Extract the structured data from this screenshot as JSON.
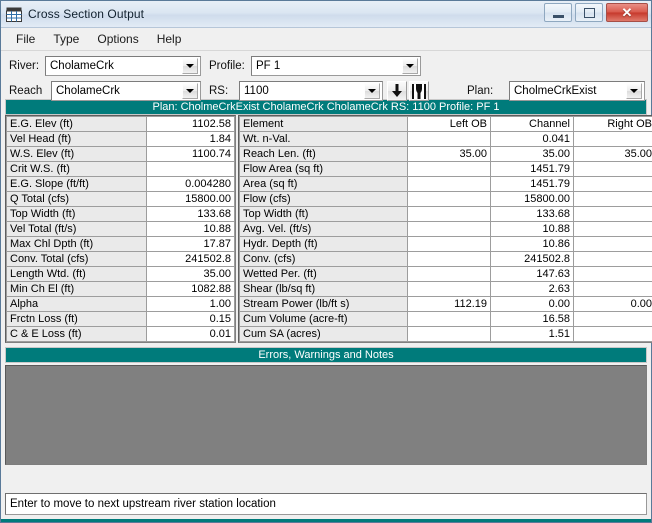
{
  "window": {
    "title": "Cross Section Output",
    "icon": "table-grid-icon",
    "minimize_label": "",
    "maximize_label": "",
    "close_label": "✕"
  },
  "menu": {
    "items": [
      {
        "label": "File"
      },
      {
        "label": "Type"
      },
      {
        "label": "Options"
      },
      {
        "label": "Help"
      }
    ]
  },
  "selectors": {
    "river_label": "River:",
    "river_value": "CholameCrk",
    "reach_label": "Reach",
    "reach_value": "CholameCrk",
    "profile_label": "Profile:",
    "profile_value": "PF 1",
    "rs_label": "RS:",
    "rs_value": "1100",
    "plan_label": "Plan:",
    "plan_value": "CholmeCrkExist",
    "next_rs_button": "down-arrow-icon",
    "xs_view_button": "cross-section-icon"
  },
  "summary_bar": "Plan: CholmeCrkExist   CholameCrk   CholameCrk  RS: 1100   Profile: PF 1",
  "left_table": {
    "rows": [
      {
        "label": "E.G. Elev (ft)",
        "value": "1102.58"
      },
      {
        "label": "Vel Head (ft)",
        "value": "1.84"
      },
      {
        "label": "W.S. Elev (ft)",
        "value": "1100.74"
      },
      {
        "label": "Crit W.S. (ft)",
        "value": ""
      },
      {
        "label": "E.G. Slope (ft/ft)",
        "value": "0.004280"
      },
      {
        "label": "Q Total (cfs)",
        "value": "15800.00"
      },
      {
        "label": "Top Width (ft)",
        "value": "133.68"
      },
      {
        "label": "Vel Total (ft/s)",
        "value": "10.88"
      },
      {
        "label": "Max Chl Dpth (ft)",
        "value": "17.87"
      },
      {
        "label": "Conv. Total (cfs)",
        "value": "241502.8"
      },
      {
        "label": "Length Wtd. (ft)",
        "value": "35.00"
      },
      {
        "label": "Min Ch El (ft)",
        "value": "1082.88"
      },
      {
        "label": "Alpha",
        "value": "1.00"
      },
      {
        "label": "Frctn Loss (ft)",
        "value": "0.15"
      },
      {
        "label": "C & E Loss (ft)",
        "value": "0.01"
      }
    ]
  },
  "right_table": {
    "headers": [
      "Element",
      "Left OB",
      "Channel",
      "Right OB"
    ],
    "rows": [
      {
        "element": "Wt. n-Val.",
        "left_ob": "",
        "channel": "0.041",
        "right_ob": ""
      },
      {
        "element": "Reach Len. (ft)",
        "left_ob": "35.00",
        "channel": "35.00",
        "right_ob": "35.00"
      },
      {
        "element": "Flow Area (sq ft)",
        "left_ob": "",
        "channel": "1451.79",
        "right_ob": ""
      },
      {
        "element": "Area (sq ft)",
        "left_ob": "",
        "channel": "1451.79",
        "right_ob": ""
      },
      {
        "element": "Flow (cfs)",
        "left_ob": "",
        "channel": "15800.00",
        "right_ob": ""
      },
      {
        "element": "Top Width (ft)",
        "left_ob": "",
        "channel": "133.68",
        "right_ob": ""
      },
      {
        "element": "Avg. Vel. (ft/s)",
        "left_ob": "",
        "channel": "10.88",
        "right_ob": ""
      },
      {
        "element": "Hydr. Depth (ft)",
        "left_ob": "",
        "channel": "10.86",
        "right_ob": ""
      },
      {
        "element": "Conv. (cfs)",
        "left_ob": "",
        "channel": "241502.8",
        "right_ob": ""
      },
      {
        "element": "Wetted Per. (ft)",
        "left_ob": "",
        "channel": "147.63",
        "right_ob": ""
      },
      {
        "element": "Shear (lb/sq ft)",
        "left_ob": "",
        "channel": "2.63",
        "right_ob": ""
      },
      {
        "element": "Stream Power (lb/ft s)",
        "left_ob": "112.19",
        "channel": "0.00",
        "right_ob": "0.00"
      },
      {
        "element": "Cum Volume (acre-ft)",
        "left_ob": "",
        "channel": "16.58",
        "right_ob": ""
      },
      {
        "element": "Cum SA (acres)",
        "left_ob": "",
        "channel": "1.51",
        "right_ob": ""
      }
    ]
  },
  "errors_panel": {
    "title": "Errors, Warnings and Notes",
    "content": ""
  },
  "status_bar": {
    "text": "Enter to move to next upstream river station location"
  },
  "colors": {
    "teal": "#007b7b",
    "header_gray": "#eaeaea",
    "panel_gray": "#808080",
    "close_red": "#c6392c"
  }
}
